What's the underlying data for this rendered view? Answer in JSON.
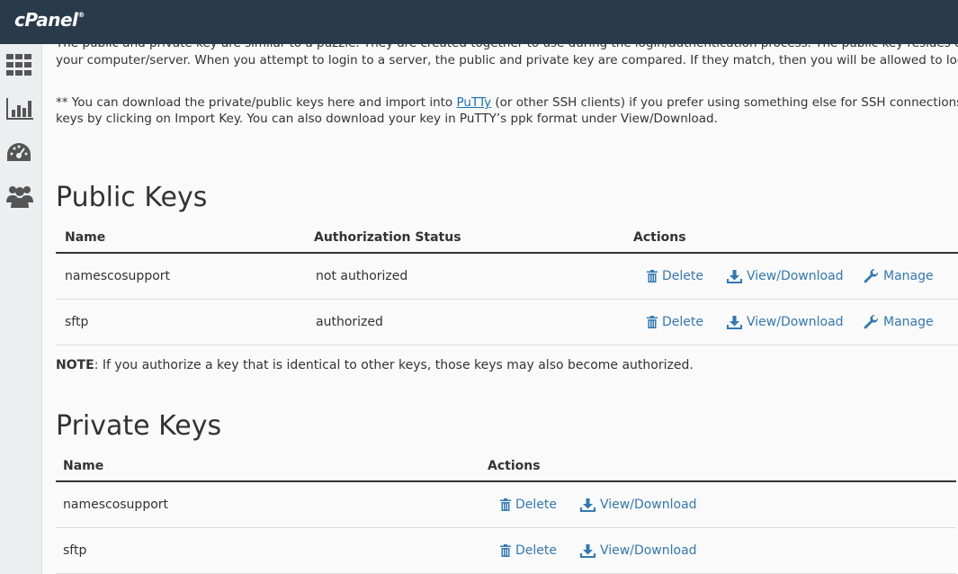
{
  "header": {
    "logo_text": "cPanel"
  },
  "sidebar": {
    "items": [
      {
        "icon": "grid-icon"
      },
      {
        "icon": "bar-chart-icon"
      },
      {
        "icon": "dashboard-gauge-icon"
      },
      {
        "icon": "users-icon"
      }
    ]
  },
  "intro": {
    "line1": "The public and private key are similar to a puzzle. They are created together to use during the login/authentication process. The public key resides on the s",
    "line2": "your computer/server. When you attempt to login to a server, the public and private key are compared. If they match, then you will be allowed to login to th",
    "line3_prefix": "** You can download the private/public keys here and import into ",
    "putty_link": "PuTTy",
    "line3_suffix": " (or other SSH clients) if you prefer using something else for SSH connections. Or, i",
    "line4": "keys by clicking on Import Key. You can also download your key in PuTTY’s ppk format under View/Download."
  },
  "public_keys": {
    "title": "Public Keys",
    "headers": {
      "name": "Name",
      "status": "Authorization Status",
      "actions": "Actions"
    },
    "rows": [
      {
        "name": "namescosupport",
        "status": "not authorized"
      },
      {
        "name": "sftp",
        "status": "authorized"
      }
    ],
    "actions": {
      "delete": "Delete",
      "download": "View/Download",
      "manage": "Manage"
    },
    "note_label": "NOTE",
    "note_text": ": If you authorize a key that is identical to other keys, those keys may also become authorized."
  },
  "private_keys": {
    "title": "Private Keys",
    "headers": {
      "name": "Name",
      "actions": "Actions"
    },
    "rows": [
      {
        "name": "namescosupport"
      },
      {
        "name": "sftp"
      }
    ],
    "actions": {
      "delete": "Delete",
      "download": "View/Download"
    }
  },
  "colors": {
    "header_bg": "#293a4a",
    "link": "#3278b4",
    "sidebar_bg": "#eceff0"
  }
}
